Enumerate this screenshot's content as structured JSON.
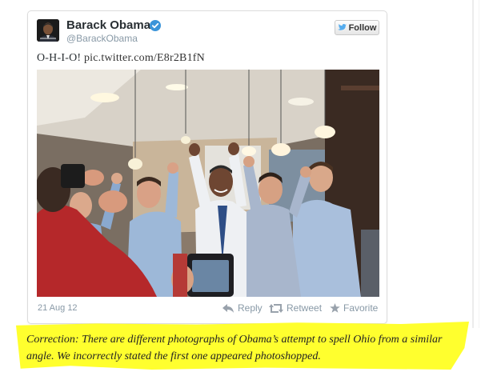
{
  "tweet": {
    "author_name": "Barack Obama",
    "author_handle": "@BarackObama",
    "follow_label": "Follow",
    "text_prefix": "O-H-I-O! ",
    "text_link": "pic.twitter.com/E8r2B1fN",
    "timestamp": "21 Aug 12",
    "actions": {
      "reply": "Reply",
      "retweet": "Retweet",
      "favorite": "Favorite"
    },
    "icons": {
      "verified": "verified-badge-icon",
      "follow": "twitter-bird-icon",
      "reply": "reply-arrow-icon",
      "retweet": "retweet-icon",
      "favorite": "star-icon"
    }
  },
  "correction": {
    "text": "Correction: There are different photographs of Obama’s attempt to spell Ohio from a similar angle. We incorrectly stated the first one appeared photoshopped."
  },
  "colors": {
    "verified_blue": "#3b94d9",
    "twitter_blue": "#55acee",
    "highlight_yellow": "#ffff2e",
    "meta_gray": "#8899a6"
  }
}
